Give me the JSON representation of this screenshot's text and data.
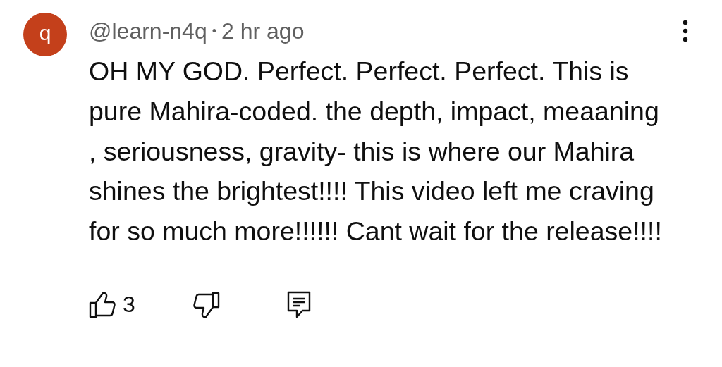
{
  "comment": {
    "avatar": {
      "letter": "q",
      "color": "#c4401b"
    },
    "author": "@learn-n4q",
    "separator": "•",
    "time": "2 hr ago",
    "text": "OH MY GOD. Perfect. Perfect. Perfect. This is pure Mahira-coded. the depth, impact, meaaning , seriousness, gravity- this is where our Mahira shines the brightest!!!! This video left me craving for so much more!!!!!! Cant wait for the release!!!!",
    "likes": "3"
  }
}
